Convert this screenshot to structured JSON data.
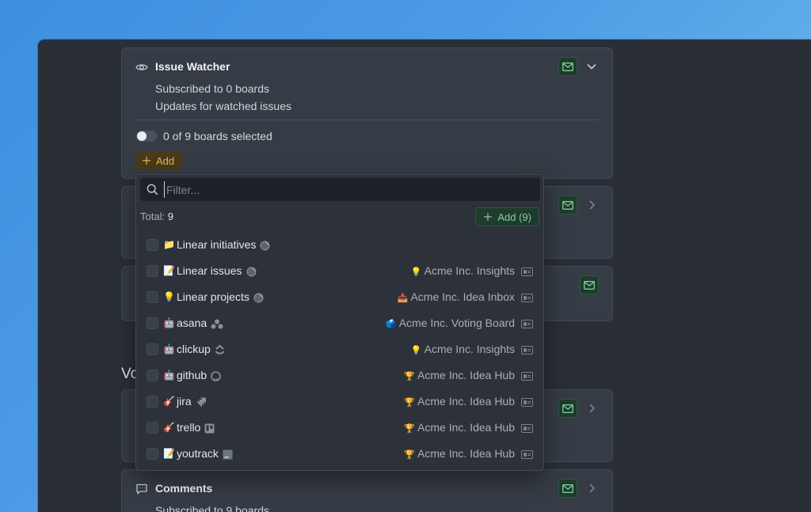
{
  "cards": {
    "issue_watcher": {
      "title": "Issue Watcher",
      "subtitle1": "Subscribed to 0 boards",
      "subtitle2": "Updates for watched issues",
      "toggle_label": "0 of 9 boards selected",
      "add_label": "Add"
    },
    "comments": {
      "title": "Comments",
      "subtitle1": "Subscribed to 9 boards"
    },
    "section_heading_partial": "Vo"
  },
  "dropdown": {
    "filter_placeholder": "Filter...",
    "total_label": "Total:",
    "total_value": "9",
    "add_all_label": "Add (9)",
    "items": [
      {
        "emoji": "📁",
        "name": "Linear initiatives",
        "brand": "linear",
        "board_emoji": "",
        "board": ""
      },
      {
        "emoji": "📝",
        "name": "Linear issues",
        "brand": "linear",
        "board_emoji": "💡",
        "board": "Acme Inc. Insights"
      },
      {
        "emoji": "💡",
        "name": "Linear projects",
        "brand": "linear",
        "board_emoji": "📥",
        "board": "Acme Inc. Idea Inbox"
      },
      {
        "emoji": "🤖",
        "name": "asana",
        "brand": "asana",
        "board_emoji": "🗳️",
        "board": "Acme Inc. Voting Board"
      },
      {
        "emoji": "🤖",
        "name": "clickup",
        "brand": "clickup",
        "board_emoji": "💡",
        "board": "Acme Inc. Insights"
      },
      {
        "emoji": "🤖",
        "name": "github",
        "brand": "github",
        "board_emoji": "🏆",
        "board": "Acme Inc. Idea Hub"
      },
      {
        "emoji": "🎸",
        "name": "jira",
        "brand": "jira",
        "board_emoji": "🏆",
        "board": "Acme Inc. Idea Hub"
      },
      {
        "emoji": "🎸",
        "name": "trello",
        "brand": "trello",
        "board_emoji": "🏆",
        "board": "Acme Inc. Idea Hub"
      },
      {
        "emoji": "📝",
        "name": "youtrack",
        "brand": "youtrack",
        "board_emoji": "🏆",
        "board": "Acme Inc. Idea Hub"
      }
    ]
  },
  "colors": {
    "accent_green": "#7fcf9b",
    "accent_amber": "#e6b757",
    "panel": "#363c45"
  }
}
